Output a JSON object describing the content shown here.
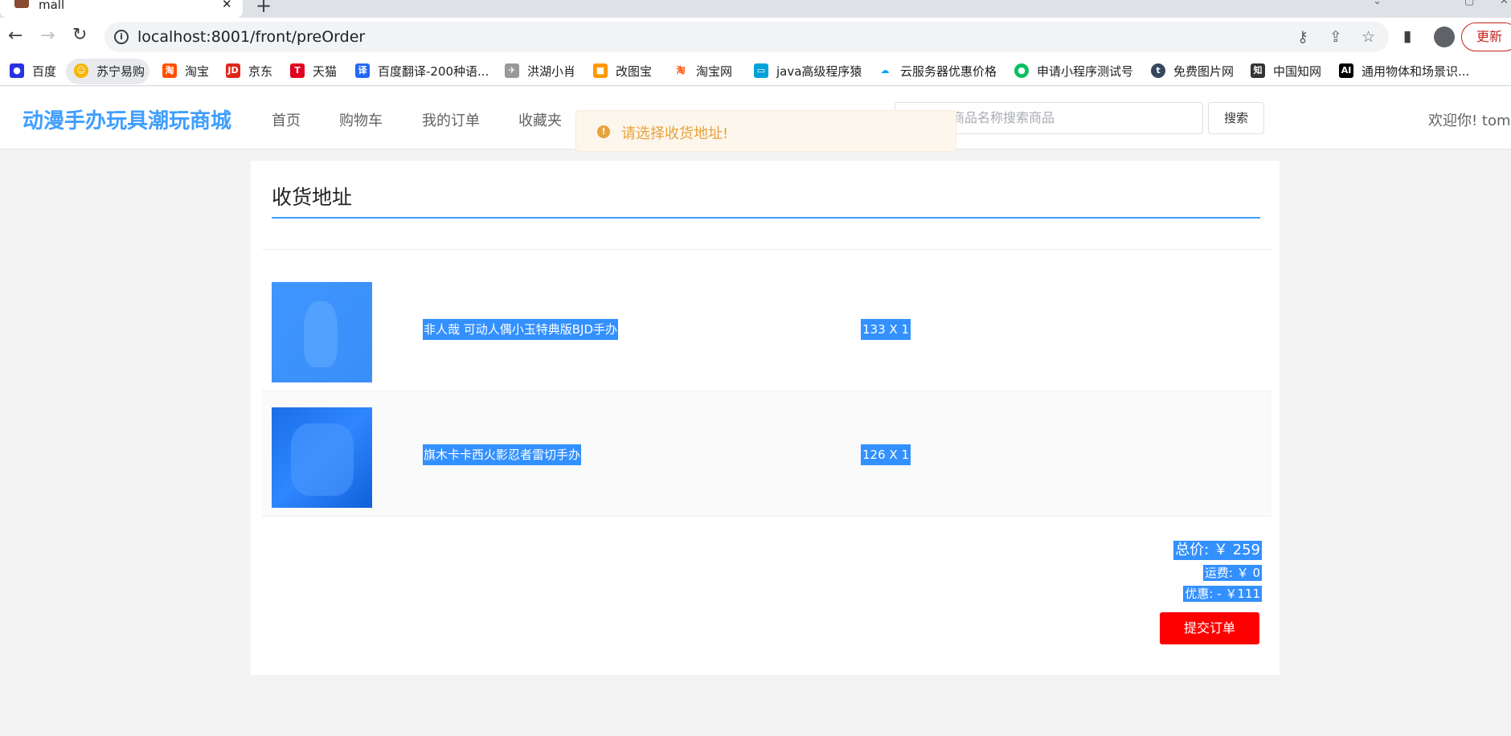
{
  "browser": {
    "tab_title": "mall",
    "url_host": "localhost",
    "url_rest": ":8001/front/preOrder",
    "update_label": "更新"
  },
  "bookmarks": [
    {
      "label": "百度",
      "icon": "baidu-paw-icon",
      "color": "#2932e1"
    },
    {
      "label": "苏宁易购",
      "icon": "suning-icon",
      "color": "#f7b500"
    },
    {
      "label": "淘宝",
      "icon": "taobao-icon",
      "color": "#ff5000"
    },
    {
      "label": "京东",
      "icon": "jd-icon",
      "color": "#e1251b"
    },
    {
      "label": "天猫",
      "icon": "tmall-icon",
      "color": "#e1001e"
    },
    {
      "label": "百度翻译-200种语...",
      "icon": "translate-icon",
      "color": "#2468f2"
    },
    {
      "label": "洪湖小肖",
      "icon": "bird-icon",
      "color": "#777777"
    },
    {
      "label": "改图宝",
      "icon": "gaitubao-icon",
      "color": "#ff9800"
    },
    {
      "label": "淘宝网",
      "icon": "taobao-net-icon",
      "color": "#ff5000"
    },
    {
      "label": "java高级程序猿",
      "icon": "bilibili-icon",
      "color": "#00a1d6"
    },
    {
      "label": "云服务器优惠价格",
      "icon": "cloud-icon",
      "color": "#00a3ff"
    },
    {
      "label": "申请小程序测试号",
      "icon": "wechat-icon",
      "color": "#07c160"
    },
    {
      "label": "免费图片网",
      "icon": "tumblr-icon",
      "color": "#36465d"
    },
    {
      "label": "中国知网",
      "icon": "cnki-icon",
      "color": "#333333"
    },
    {
      "label": "通用物体和场景识...",
      "icon": "ai-icon",
      "color": "#000000"
    }
  ],
  "site": {
    "logo": "动漫手办玩具潮玩商城",
    "menu": [
      "首页",
      "购物车",
      "我的订单",
      "收藏夹"
    ],
    "search_placeholder": "商品名称搜索商品",
    "search_button": "搜索",
    "welcome": "欢迎你!  tom"
  },
  "toast": {
    "text": "请选择收货地址!",
    "color": "#e6a23c"
  },
  "order": {
    "section_title": "收货地址",
    "items": [
      {
        "name": "非人哉 可动人偶小玉特典版BJD手办",
        "qty_text": "133 X 1"
      },
      {
        "name": "旗木卡卡西火影忍者雷切手办",
        "qty_text": "126 X 1"
      }
    ],
    "total": "总价: ￥ 259",
    "shipping": "运费: ￥ 0",
    "discount": "优惠: - ￥111",
    "submit_label": "提交订单"
  },
  "colors": {
    "accent": "#409eff",
    "selection": "#3390ff",
    "submit": "#ff0000"
  }
}
